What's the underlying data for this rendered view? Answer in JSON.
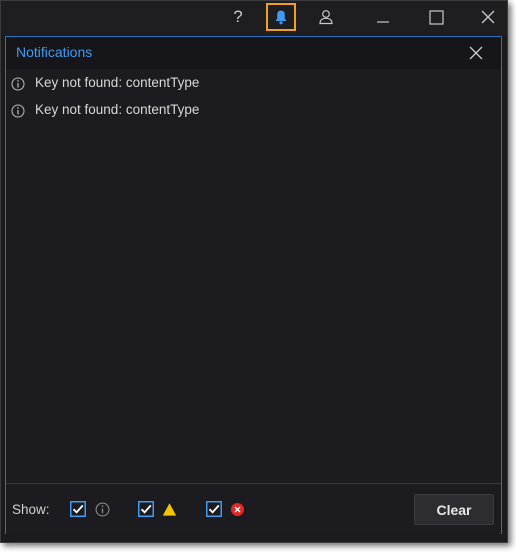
{
  "titlebar": {
    "help_label": "?",
    "icons": [
      "help-icon",
      "bell-icon",
      "user-icon",
      "minimize-icon",
      "maximize-icon",
      "close-icon"
    ],
    "active_accent": "#f0a01e"
  },
  "panel": {
    "title": "Notifications",
    "title_color": "#3e9bf0",
    "border_color": "#2e6fb8",
    "items": [
      {
        "icon": "info-icon",
        "message": "Key not found: contentType"
      },
      {
        "icon": "info-icon",
        "message": "Key not found: contentType"
      }
    ]
  },
  "footer": {
    "show_label": "Show:",
    "filters": [
      {
        "type": "info",
        "checked": true,
        "icon": "info-icon"
      },
      {
        "type": "warning",
        "checked": true,
        "icon": "warning-icon",
        "color": "#f5c400"
      },
      {
        "type": "error",
        "checked": true,
        "icon": "error-icon",
        "color": "#e02a2a"
      }
    ],
    "clear_label": "Clear"
  }
}
